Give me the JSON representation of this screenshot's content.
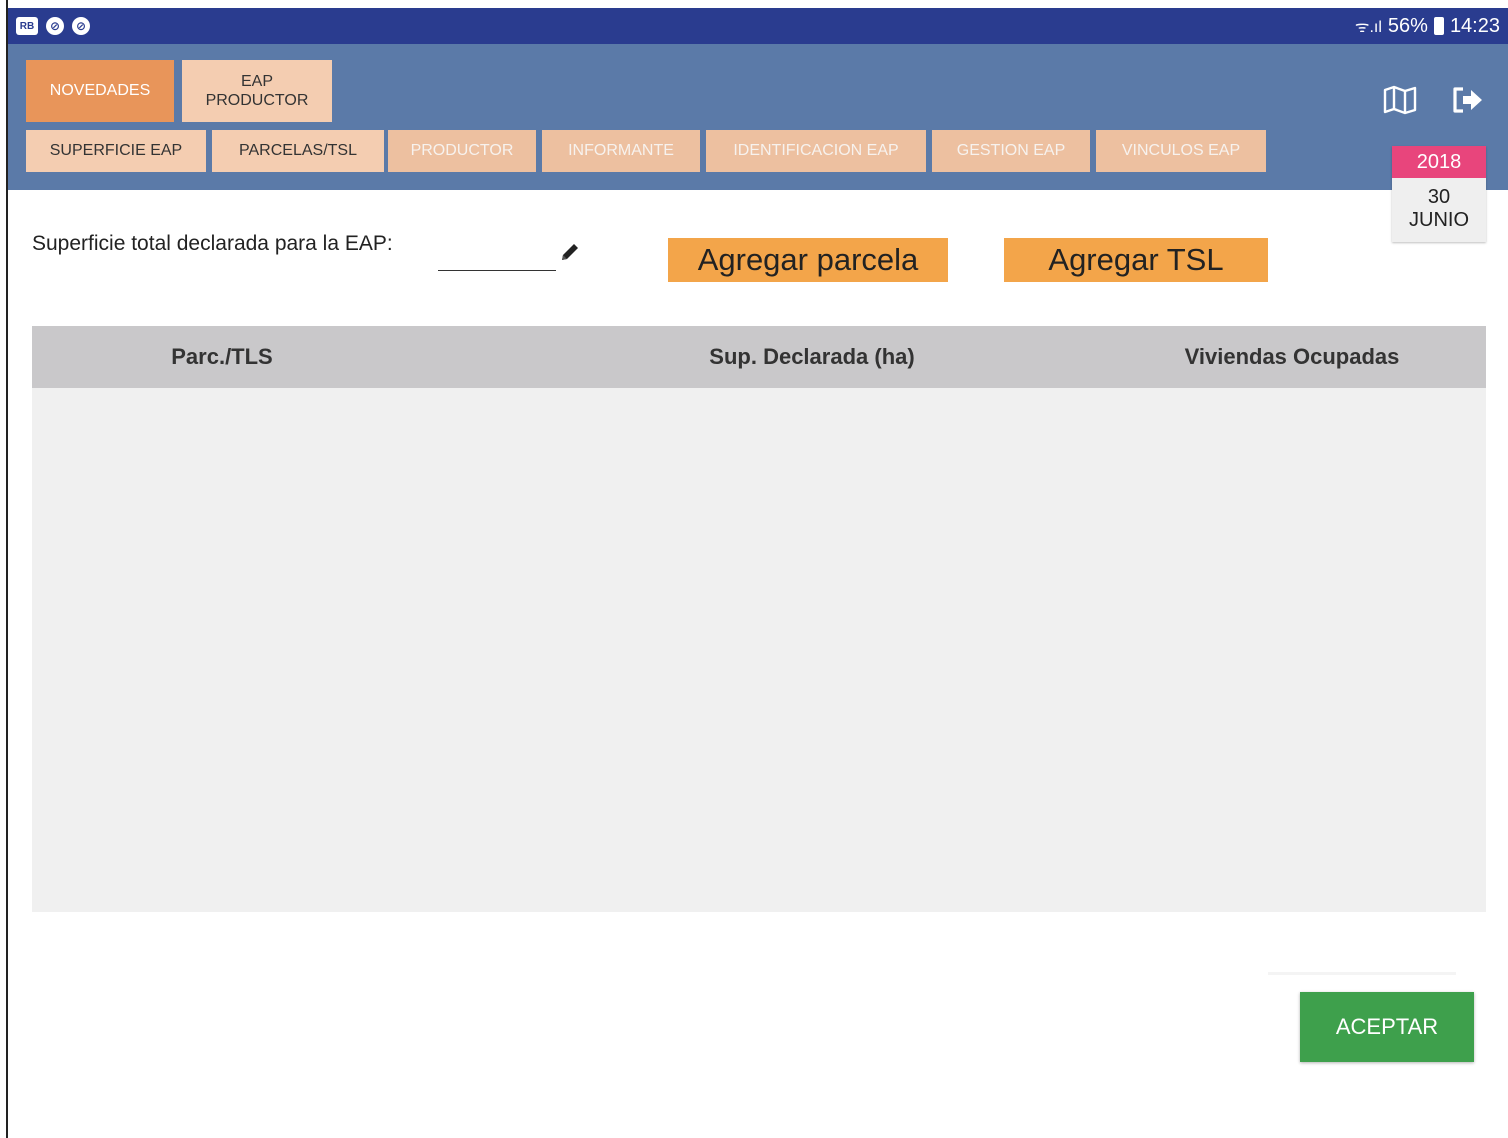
{
  "statusbar": {
    "left_badge": "RB",
    "left_icons": [
      "sync-icon",
      "sync-icon"
    ],
    "battery_percent": "56%",
    "time": "14:23"
  },
  "tabs": {
    "top": [
      {
        "label": "NOVEDADES",
        "active": true
      },
      {
        "label": "EAP\nPRODUCTOR",
        "active": false
      }
    ],
    "sub": [
      {
        "label": "SUPERFICIE EAP",
        "enabled": true
      },
      {
        "label": "PARCELAS/TSL",
        "enabled": true
      },
      {
        "label": "PRODUCTOR",
        "enabled": false
      },
      {
        "label": "INFORMANTE",
        "enabled": false
      },
      {
        "label": "IDENTIFICACION EAP",
        "enabled": false
      },
      {
        "label": "GESTION EAP",
        "enabled": false
      },
      {
        "label": "VINCULOS EAP",
        "enabled": false
      }
    ]
  },
  "toolbar_icons": {
    "map": "map-icon",
    "exit": "logout-icon"
  },
  "date_card": {
    "year": "2018",
    "day": "30",
    "month": "JUNIO"
  },
  "form": {
    "superficie_label": "Superficie total declarada para la EAP:",
    "superficie_value": ""
  },
  "actions": {
    "add_parcela": "Agregar parcela",
    "add_tsl": "Agregar TSL",
    "accept": "ACEPTAR"
  },
  "table": {
    "columns": [
      "Parc./TLS",
      "Sup. Declarada (ha)",
      "Viviendas Ocupadas"
    ],
    "rows": []
  },
  "colors": {
    "statusbar": "#2a3c8f",
    "appbar": "#5b7aa8",
    "active_tab": "#e8955a",
    "tab": "#f4cdb1",
    "orange_button": "#f3a54a",
    "accept_button": "#3ea04c",
    "date_year": "#e8457c",
    "table_header": "#c9c8ca"
  }
}
